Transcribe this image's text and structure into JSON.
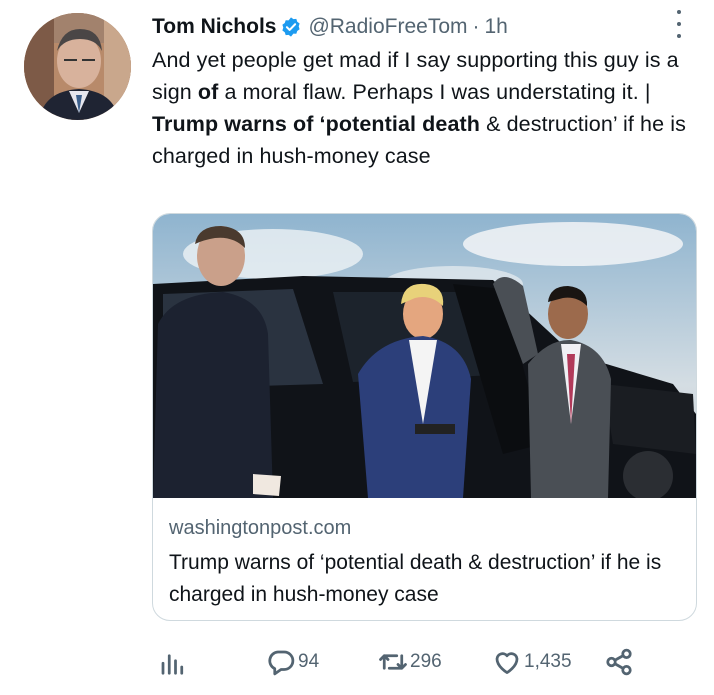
{
  "tweet": {
    "author_name": "Tom Nichols",
    "handle": "@RadioFreeTom",
    "separator": "·",
    "time": "1h",
    "text_parts": {
      "p1": "And yet people get mad if I say supporting this guy is a sign ",
      "p1_bold": "of",
      "p2": " a moral flaw. Perhaps I was understating it. | ",
      "p3_bold": "Trump warns of ‘potential death",
      "p4": " & destruction’ if he is charged in hush-money case"
    }
  },
  "card": {
    "domain": "washingtonpost.com",
    "title": "Trump warns of ‘potential death & destruction’ if he is charged in hush-money case"
  },
  "actions": {
    "views_icon": "bar-chart-icon",
    "replies": "94",
    "retweets": "296",
    "likes": "1,435",
    "share_icon": "share-icon"
  },
  "colors": {
    "text": "#0f1419",
    "secondary": "#536471",
    "verified": "#1d9bf0",
    "border": "#cfd9de"
  }
}
